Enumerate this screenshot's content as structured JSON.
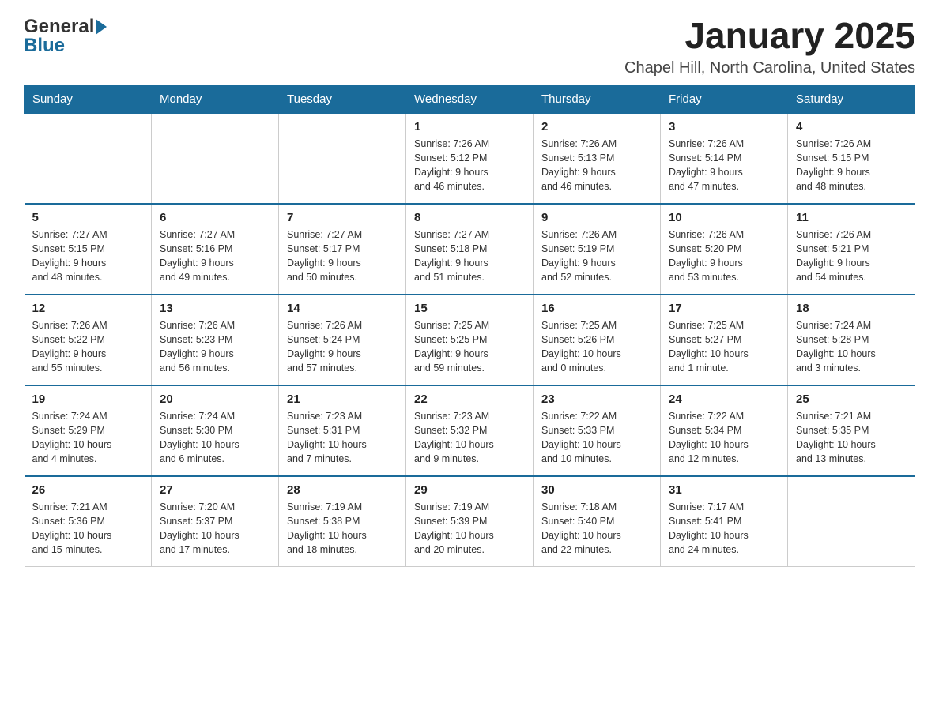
{
  "header": {
    "logo_line1": "General",
    "logo_line2": "Blue",
    "title": "January 2025",
    "subtitle": "Chapel Hill, North Carolina, United States"
  },
  "calendar": {
    "days_of_week": [
      "Sunday",
      "Monday",
      "Tuesday",
      "Wednesday",
      "Thursday",
      "Friday",
      "Saturday"
    ],
    "weeks": [
      [
        {
          "day": "",
          "info": ""
        },
        {
          "day": "",
          "info": ""
        },
        {
          "day": "",
          "info": ""
        },
        {
          "day": "1",
          "info": "Sunrise: 7:26 AM\nSunset: 5:12 PM\nDaylight: 9 hours\nand 46 minutes."
        },
        {
          "day": "2",
          "info": "Sunrise: 7:26 AM\nSunset: 5:13 PM\nDaylight: 9 hours\nand 46 minutes."
        },
        {
          "day": "3",
          "info": "Sunrise: 7:26 AM\nSunset: 5:14 PM\nDaylight: 9 hours\nand 47 minutes."
        },
        {
          "day": "4",
          "info": "Sunrise: 7:26 AM\nSunset: 5:15 PM\nDaylight: 9 hours\nand 48 minutes."
        }
      ],
      [
        {
          "day": "5",
          "info": "Sunrise: 7:27 AM\nSunset: 5:15 PM\nDaylight: 9 hours\nand 48 minutes."
        },
        {
          "day": "6",
          "info": "Sunrise: 7:27 AM\nSunset: 5:16 PM\nDaylight: 9 hours\nand 49 minutes."
        },
        {
          "day": "7",
          "info": "Sunrise: 7:27 AM\nSunset: 5:17 PM\nDaylight: 9 hours\nand 50 minutes."
        },
        {
          "day": "8",
          "info": "Sunrise: 7:27 AM\nSunset: 5:18 PM\nDaylight: 9 hours\nand 51 minutes."
        },
        {
          "day": "9",
          "info": "Sunrise: 7:26 AM\nSunset: 5:19 PM\nDaylight: 9 hours\nand 52 minutes."
        },
        {
          "day": "10",
          "info": "Sunrise: 7:26 AM\nSunset: 5:20 PM\nDaylight: 9 hours\nand 53 minutes."
        },
        {
          "day": "11",
          "info": "Sunrise: 7:26 AM\nSunset: 5:21 PM\nDaylight: 9 hours\nand 54 minutes."
        }
      ],
      [
        {
          "day": "12",
          "info": "Sunrise: 7:26 AM\nSunset: 5:22 PM\nDaylight: 9 hours\nand 55 minutes."
        },
        {
          "day": "13",
          "info": "Sunrise: 7:26 AM\nSunset: 5:23 PM\nDaylight: 9 hours\nand 56 minutes."
        },
        {
          "day": "14",
          "info": "Sunrise: 7:26 AM\nSunset: 5:24 PM\nDaylight: 9 hours\nand 57 minutes."
        },
        {
          "day": "15",
          "info": "Sunrise: 7:25 AM\nSunset: 5:25 PM\nDaylight: 9 hours\nand 59 minutes."
        },
        {
          "day": "16",
          "info": "Sunrise: 7:25 AM\nSunset: 5:26 PM\nDaylight: 10 hours\nand 0 minutes."
        },
        {
          "day": "17",
          "info": "Sunrise: 7:25 AM\nSunset: 5:27 PM\nDaylight: 10 hours\nand 1 minute."
        },
        {
          "day": "18",
          "info": "Sunrise: 7:24 AM\nSunset: 5:28 PM\nDaylight: 10 hours\nand 3 minutes."
        }
      ],
      [
        {
          "day": "19",
          "info": "Sunrise: 7:24 AM\nSunset: 5:29 PM\nDaylight: 10 hours\nand 4 minutes."
        },
        {
          "day": "20",
          "info": "Sunrise: 7:24 AM\nSunset: 5:30 PM\nDaylight: 10 hours\nand 6 minutes."
        },
        {
          "day": "21",
          "info": "Sunrise: 7:23 AM\nSunset: 5:31 PM\nDaylight: 10 hours\nand 7 minutes."
        },
        {
          "day": "22",
          "info": "Sunrise: 7:23 AM\nSunset: 5:32 PM\nDaylight: 10 hours\nand 9 minutes."
        },
        {
          "day": "23",
          "info": "Sunrise: 7:22 AM\nSunset: 5:33 PM\nDaylight: 10 hours\nand 10 minutes."
        },
        {
          "day": "24",
          "info": "Sunrise: 7:22 AM\nSunset: 5:34 PM\nDaylight: 10 hours\nand 12 minutes."
        },
        {
          "day": "25",
          "info": "Sunrise: 7:21 AM\nSunset: 5:35 PM\nDaylight: 10 hours\nand 13 minutes."
        }
      ],
      [
        {
          "day": "26",
          "info": "Sunrise: 7:21 AM\nSunset: 5:36 PM\nDaylight: 10 hours\nand 15 minutes."
        },
        {
          "day": "27",
          "info": "Sunrise: 7:20 AM\nSunset: 5:37 PM\nDaylight: 10 hours\nand 17 minutes."
        },
        {
          "day": "28",
          "info": "Sunrise: 7:19 AM\nSunset: 5:38 PM\nDaylight: 10 hours\nand 18 minutes."
        },
        {
          "day": "29",
          "info": "Sunrise: 7:19 AM\nSunset: 5:39 PM\nDaylight: 10 hours\nand 20 minutes."
        },
        {
          "day": "30",
          "info": "Sunrise: 7:18 AM\nSunset: 5:40 PM\nDaylight: 10 hours\nand 22 minutes."
        },
        {
          "day": "31",
          "info": "Sunrise: 7:17 AM\nSunset: 5:41 PM\nDaylight: 10 hours\nand 24 minutes."
        },
        {
          "day": "",
          "info": ""
        }
      ]
    ]
  }
}
